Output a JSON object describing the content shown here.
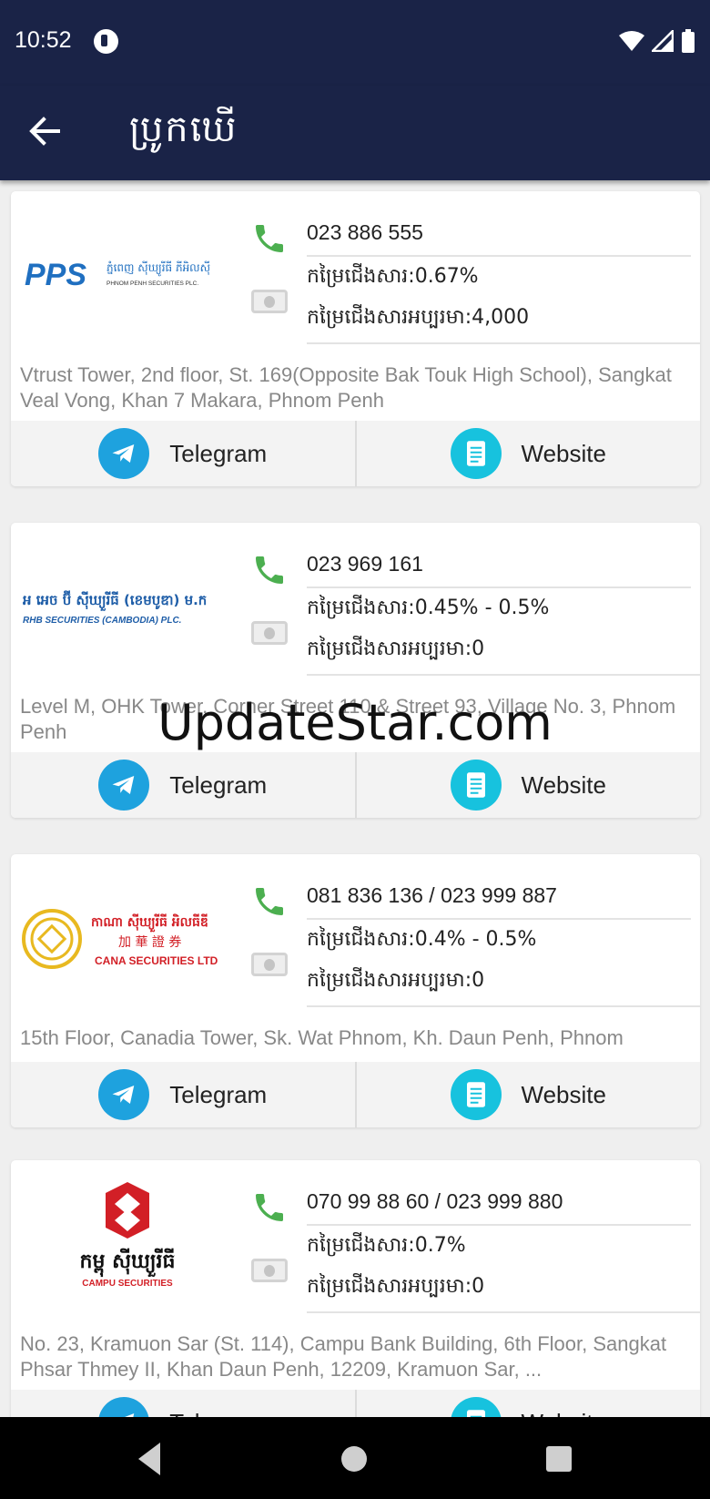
{
  "status": {
    "time": "10:52"
  },
  "appbar": {
    "title": "ប្រូកឃើ"
  },
  "watermark": "UpdateStar.com",
  "brokers": [
    {
      "logo_text": "ភ្នំពេញ ស៊ីឃ្យូរីធី ភីអិលស៊ី",
      "logo_subtext": "PHNOM PENH SECURITIES PLC.",
      "logo_mark": "PPS",
      "phone": "023 886 555",
      "fee": "កម្រៃជើងសារ:0.67%",
      "min_fee": "កម្រៃជើងសារអប្បរមា:4,000",
      "address": "Vtrust Tower, 2nd floor, St. 169(Opposite Bak Touk High School), Sangkat Veal Vong, Khan 7 Makara, Phnom Penh",
      "telegram_label": "Telegram",
      "website_label": "Website"
    },
    {
      "logo_text": "អ អេច ប៊ី ស៊ីឃ្យួរីធី (ខេមបូឌា) ម.ក",
      "logo_subtext": "RHB SECURITIES (CAMBODIA) PLC.",
      "phone": "023 969 161",
      "fee": "កម្រៃជើងសារ:0.45% - 0.5%",
      "min_fee": "កម្រៃជើងសារអប្បរមា:0",
      "address": "Level M, OHK Tower, Corner Street 110 & Street 93, Village No. 3, Phnom Penh",
      "telegram_label": "Telegram",
      "website_label": "Website"
    },
    {
      "logo_text": "កាណា ស៊ីឃ្យួរីធី អិលធីឌី",
      "logo_cn": "加 華 證 券",
      "logo_subtext": "CANA SECURITIES LTD",
      "phone": "081 836 136 / 023 999 887",
      "fee": "កម្រៃជើងសារ:0.4% - 0.5%",
      "min_fee": "កម្រៃជើងសារអប្បរមា:0",
      "address": "15th Floor, Canadia Tower, Sk. Wat Phnom, Kh. Daun Penh, Phnom",
      "telegram_label": "Telegram",
      "website_label": "Website"
    },
    {
      "logo_text": "កម្ពុ ស៊ីឃ្យួរីធី",
      "logo_subtext": "CAMPU SECURITIES",
      "phone": "070 99 88 60 / 023 999 880",
      "fee": "កម្រៃជើងសារ:0.7%",
      "min_fee": "កម្រៃជើងសារអប្បរមា:0",
      "address": "No. 23, Kramuon Sar (St. 114), Campu Bank Building, 6th Floor, Sangkat Phsar Thmey II, Khan Daun Penh, 12209, Kramuon Sar, ...",
      "telegram_label": "Telegram",
      "website_label": "Website"
    }
  ],
  "colors": {
    "bar": "#1a2347",
    "telegram": "#1ea2de",
    "website": "#17c2de",
    "phone_icon": "#4caf50"
  },
  "icons": [
    "cast-icon",
    "wifi-icon",
    "signal-icon",
    "battery-icon",
    "back-arrow-icon",
    "phone-icon",
    "money-icon",
    "telegram-icon",
    "document-icon"
  ]
}
